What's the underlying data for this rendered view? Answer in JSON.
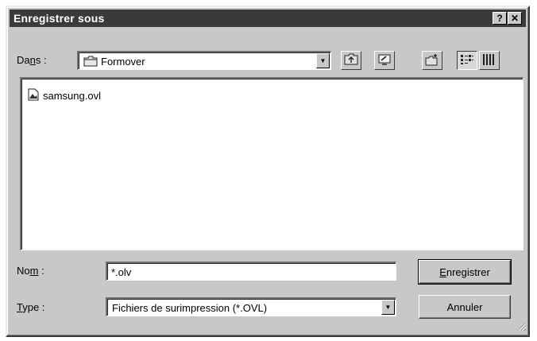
{
  "window": {
    "title": "Enregistrer sous",
    "help_label": "?",
    "close_label": "✕"
  },
  "location": {
    "label_prefix": "Da",
    "label_accel": "n",
    "label_suffix": "s :",
    "value": "Formover"
  },
  "toolbar": {
    "icons": [
      "up-folder-icon",
      "desktop-icon",
      "new-folder-icon",
      "list-view-icon",
      "details-view-icon"
    ],
    "active_view": "list"
  },
  "files": [
    {
      "name": "samsung.ovl",
      "icon": "file-icon"
    }
  ],
  "filename": {
    "label_prefix": "No",
    "label_accel": "m",
    "label_suffix": " :",
    "value": "*.olv"
  },
  "filetype": {
    "label_accel": "T",
    "label_suffix": "ype :",
    "value": "Fichiers de surimpression (*.OVL)"
  },
  "buttons": {
    "save_accel": "E",
    "save_rest": "nregistrer",
    "cancel": "Annuler"
  }
}
